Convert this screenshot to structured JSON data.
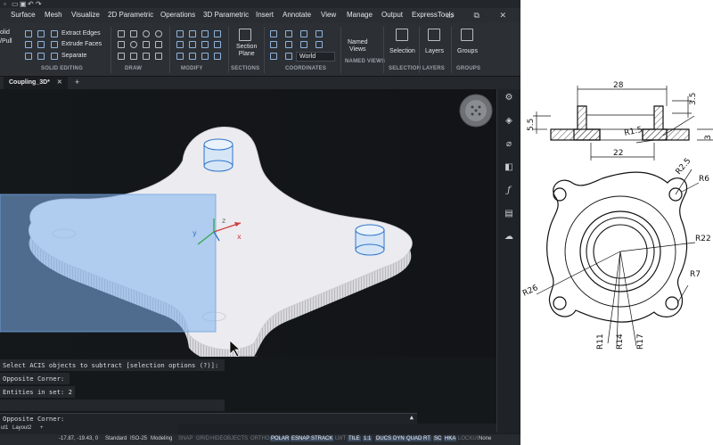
{
  "quick_access": {
    "icons": [
      "new-icon",
      "open-icon",
      "save-icon",
      "undo-icon",
      "redo-icon"
    ]
  },
  "menu": {
    "items": [
      "Surface",
      "Mesh",
      "Visualize",
      "2D Parametric",
      "Operations",
      "3D Parametric",
      "Insert",
      "Annotate",
      "View",
      "Manage",
      "Output",
      "ExpressTools"
    ]
  },
  "ribbon": {
    "push_pull": "olid\n/Pull",
    "extract_edges": "Extract Edges",
    "extrude_faces": "Extrude Faces",
    "separate": "Separate",
    "solid_editing": "SOLID EDITING",
    "draw": "DRAW",
    "modify": "MODIFY",
    "section_plane": "Section\nPlane",
    "sections": "SECTIONS",
    "world": "World",
    "coordinates": "COORDINATES",
    "named_views": "Named\nViews",
    "named_views_group": "NAMED VIEWS",
    "selection": "Selection",
    "selection_group": "SELECTION",
    "layers": "Layers",
    "layers_group": "LAYERS",
    "groups": "Groups",
    "groups_group": "GROUPS"
  },
  "document": {
    "tab": "Coupling_3D*",
    "add": "+"
  },
  "command": {
    "lines": [
      "Select ACIS objects to subtract [selection options (?)]:",
      "Opposite Corner:",
      "Entities in set: 2"
    ],
    "prompt": "Opposite Corner:"
  },
  "layout_tabs": [
    "ut1",
    "Layout2",
    "+"
  ],
  "status": {
    "coords": "-17.87, -19.43, 0",
    "style": "Standard",
    "dim": "ISO-25",
    "workspace": "Modeling",
    "toggles_on": [
      "POLAR",
      "ESNAP",
      "STRACK",
      "TILE",
      "1:1",
      "DUCS",
      "DYN",
      "QUAD",
      "RT",
      "SC",
      "HKA"
    ],
    "toggles_off": [
      "SNAP",
      "GRID",
      "HIDEOBJECTS",
      "ORTHO",
      "LWT",
      "LOCKUI"
    ],
    "none": "None"
  },
  "drawing": {
    "dims": {
      "top_width": "28",
      "step": "3.5",
      "height": "5.5",
      "right": "3",
      "bore": "22",
      "fillet": "R1.5",
      "hole": "R2.5",
      "r6": "R6",
      "r22": "R22",
      "r26": "R26",
      "r7": "R7",
      "r11": "R11",
      "r14": "R14",
      "r17": "R17"
    }
  }
}
